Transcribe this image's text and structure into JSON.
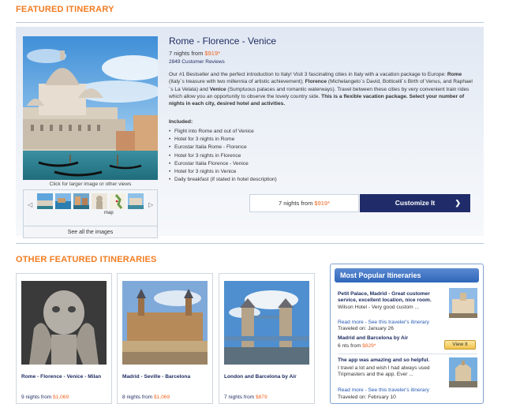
{
  "featured": {
    "section_title": "FEATURED ITINERARY",
    "title": "Rome - Florence - Venice",
    "nights_prefix": "7 nights from ",
    "price": "$919*",
    "reviews": "2849 Customer Reviews",
    "desc_intro": "Our #1 Bestseller and the perfect introduction to Italy! Visit 3 fascinating cities in Italy with a vacation package to Europe: ",
    "desc_rome": "Rome",
    "desc_rome_text": " (Italy´s treasure with two millennia of artistic achievement); ",
    "desc_florence": "Florence",
    "desc_florence_text": " (Michelangelo´s David, Botticelli´s Birth of Venus, and Raphael´s La Velata) and ",
    "desc_venice": "Venice",
    "desc_venice_text": " (Sumptuous palaces and romantic waterways). Travel between these cities by very convenient train rides which allow you an opportunity to observe the lovely country side. ",
    "desc_bold_end": "This is a flexible vacation package. Select your number of nights in each city, desired hotel and activities.",
    "included_title": "Included:",
    "included": [
      "Flight into Rome and out of Venice",
      "Hotel for 3 nights in Rome",
      "Eurostar Italia Rome - Florence",
      "Hotel for 3 nights in Florence",
      "Eurostar Italia Florence - Venice",
      "Hotel for 3 nights in Venice",
      "Daily breakfast (if stated in hotel description)"
    ],
    "image_caption": "Click for larger image or other views",
    "map_label": "map",
    "see_all": "See all the images",
    "price_box_prefix": "7 nights from ",
    "price_box_price": "$919*",
    "customize_label": "Customize It",
    "customize_chevron": "❯",
    "arrow_left": "◁",
    "arrow_right": "▷"
  },
  "others": {
    "section_title": "OTHER FEATURED ITINERARIES",
    "cards": [
      {
        "title": "Rome - Florence - Venice - Milan",
        "nights": "9 nights from ",
        "price": "$1,069"
      },
      {
        "title": "Madrid - Seville - Barcelona",
        "nights": "8 nights from ",
        "price": "$1,069"
      },
      {
        "title": "London and Barcelona by Air",
        "nights": "7 nights from ",
        "price": "$879"
      }
    ]
  },
  "popular": {
    "title": "Most Popular Itineraries",
    "review1_title": "Petit Palace, Madrid - Great customer service, excellent location, nice room.",
    "review1_text": "Wilson Hotel - Very good custom ...",
    "review1_link": "Read more - See this traveler's itinerary",
    "review1_date": "Traveled on: January 26",
    "trip_title": "Madrid and Barcelona by Air",
    "trip_nights": "6 nts from ",
    "trip_price": "$829*",
    "view_it": "View It",
    "review2_title": "The app was amazing and so helpful.",
    "review2_text1": "I travel a lot and wish I had always used",
    "review2_text2": "Tripmasters and the app. Ever ...",
    "review2_link": "Read more - See this traveler's itinerary",
    "review2_date": "Traveled on: February 10"
  },
  "colors": {
    "accent_orange": "#f27c21",
    "navy": "#1b2a5f",
    "button_navy": "#1f2c69",
    "link_blue": "#2559b4",
    "price_orange": "#f26521"
  }
}
